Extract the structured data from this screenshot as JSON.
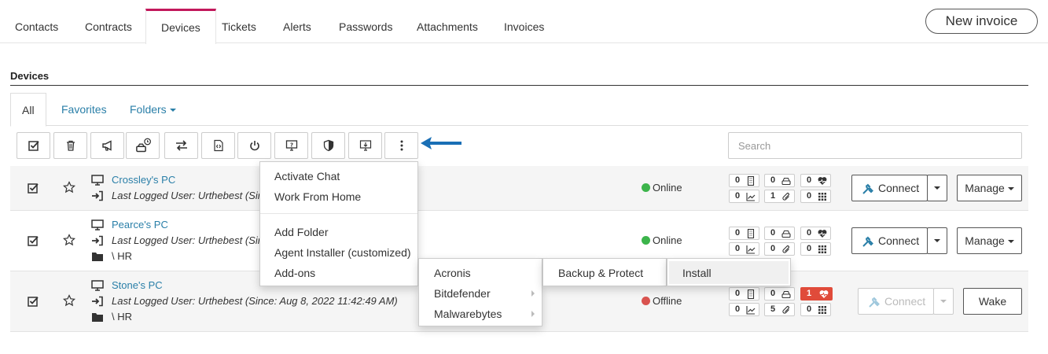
{
  "top_tabs": [
    "Contacts",
    "Contracts",
    "Devices",
    "Tickets",
    "Alerts",
    "Passwords",
    "Attachments",
    "Invoices"
  ],
  "active_top_tab": "Devices",
  "new_invoice_label": "New invoice",
  "section_title": "Devices",
  "sub_tabs": {
    "all": "All",
    "favorites": "Favorites",
    "folders": "Folders"
  },
  "search": {
    "placeholder": "Search",
    "value": ""
  },
  "toolbar_icons": [
    "select-all-icon",
    "trash-icon",
    "megaphone-icon",
    "drive-schedule-icon",
    "transfer-icon",
    "script-icon",
    "power-icon",
    "remote-help-icon",
    "shield-icon",
    "download-install-icon",
    "more-vertical-icon"
  ],
  "devices": [
    {
      "name": "Crossley's PC",
      "last_logged": "Last Logged User: Urthebest (Sinc",
      "folder": "",
      "status": "Online",
      "status_color": "#3cb44b",
      "badges": {
        "a": "0",
        "b": "0",
        "c": "0",
        "d": "0",
        "e": "1",
        "f": "0"
      },
      "connect": "Connect",
      "manage": "Manage"
    },
    {
      "name": "Pearce's PC",
      "last_logged": "Last Logged User: Urthebest (Sinc",
      "folder": "\\ HR",
      "status": "Online",
      "status_color": "#3cb44b",
      "badges": {
        "a": "0",
        "b": "0",
        "c": "0",
        "d": "0",
        "e": "0",
        "f": "0"
      },
      "connect": "Connect",
      "manage": "Manage"
    },
    {
      "name": "Stone's PC",
      "last_logged": "Last Logged User: Urthebest (Since: Aug 8, 2022 11:42:49 AM)",
      "folder": "\\ HR",
      "status": "Offline",
      "status_color": "#d9534f",
      "badges": {
        "a": "0",
        "b": "0",
        "c": "1",
        "d": "0",
        "e": "5",
        "f": "0"
      },
      "connect": "Connect",
      "manage": "Wake"
    }
  ],
  "more_menu": {
    "items_top": [
      "Activate Chat",
      "Work From Home"
    ],
    "items_bottom": [
      "Add Folder",
      "Agent Installer (customized)",
      "Add-ons"
    ]
  },
  "addons_menu": [
    "Acronis",
    "Bitdefender",
    "Malwarebytes"
  ],
  "acronis_menu": [
    "Backup & Protect"
  ],
  "backup_menu": [
    "Install"
  ],
  "colors": {
    "accent": "#c2185b",
    "link": "#2a7fa8",
    "arrow": "#1a6fb5",
    "alert_red": "#e04b3a"
  }
}
